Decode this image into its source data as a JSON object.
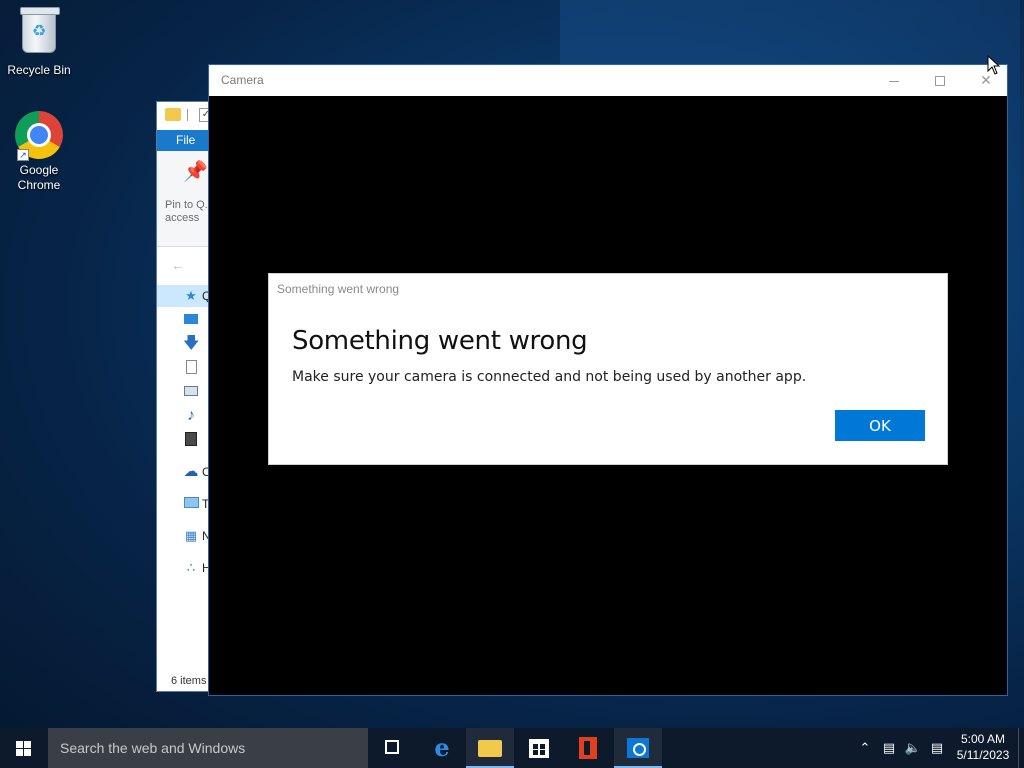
{
  "desktop": {
    "icons": [
      {
        "label": "Recycle Bin",
        "icon": "recycle-bin-icon"
      },
      {
        "label": "Google Chrome",
        "icon": "chrome-icon"
      }
    ]
  },
  "explorer": {
    "file_tab": "File",
    "pin_label": "Pin to Q... access",
    "tree": [
      {
        "label": "Q",
        "icon": "star-icon",
        "selected": true
      },
      {
        "label": "",
        "icon": "desktop-icon"
      },
      {
        "label": "",
        "icon": "downloads-icon"
      },
      {
        "label": "",
        "icon": "documents-icon"
      },
      {
        "label": "",
        "icon": "pictures-icon"
      },
      {
        "label": "",
        "icon": "music-icon"
      },
      {
        "label": "",
        "icon": "videos-icon"
      },
      {
        "label": "O",
        "icon": "onedrive-icon"
      },
      {
        "label": "T",
        "icon": "this-pc-icon"
      },
      {
        "label": "N",
        "icon": "network-icon"
      },
      {
        "label": "H",
        "icon": "homegroup-icon"
      }
    ],
    "status": "6 items"
  },
  "camera_window": {
    "title": "Camera",
    "controls": {
      "minimize": "minimize",
      "maximize": "maximize",
      "close": "close"
    }
  },
  "dialog": {
    "caption": "Something went wrong",
    "heading": "Something went wrong",
    "body": "Make sure your camera is connected and not being used by another app.",
    "ok_label": "OK",
    "accent": "#0078d7"
  },
  "taskbar": {
    "search_placeholder": "Search the web and Windows",
    "pinned": [
      "task-view-icon",
      "edge-icon",
      "file-explorer-icon",
      "store-icon",
      "office-icon",
      "camera-icon"
    ],
    "clock_time": "5:00 AM",
    "clock_date": "5/11/2023"
  }
}
